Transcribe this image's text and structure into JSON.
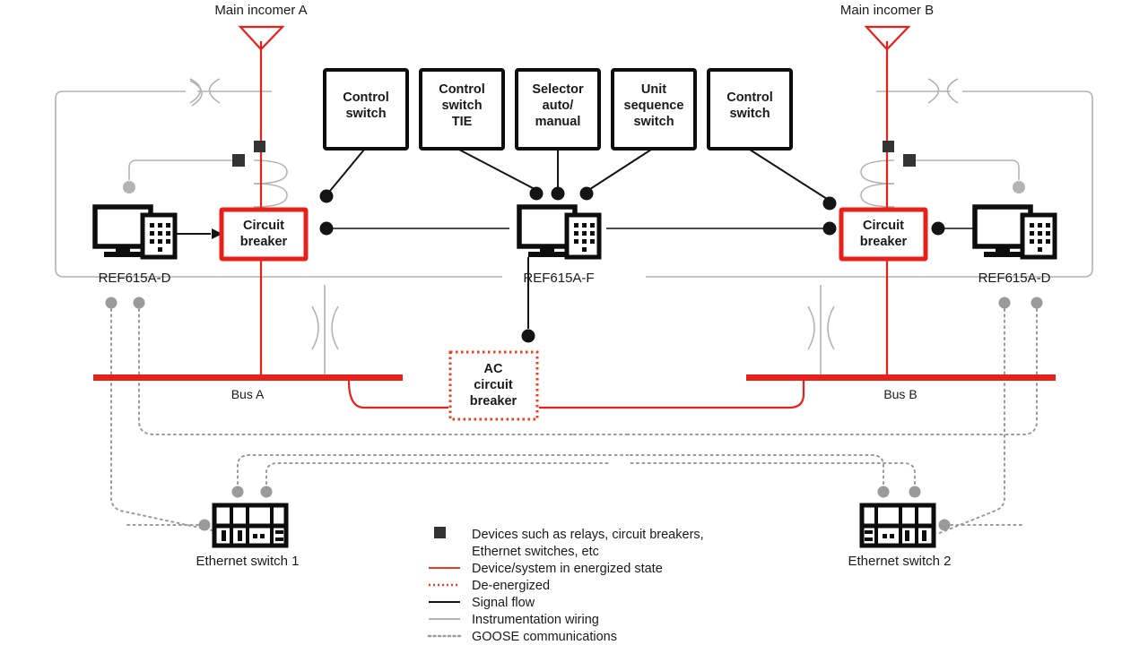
{
  "diagram": {
    "title": "Substation busbar protection single line diagram",
    "colors": {
      "energized": "#E8201A",
      "deenergized": "#EF3B24",
      "signal": "#141414",
      "instrumentation": "#B3B3B3",
      "goose": "#9A9A9A",
      "device_marker": "#333333",
      "background": "#FFFFFF"
    }
  },
  "incomers": [
    {
      "id": "incomer-a",
      "label": "Main incomer A"
    },
    {
      "id": "incomer-b",
      "label": "Main incomer B"
    }
  ],
  "switch_boxes": [
    {
      "id": "control-switch-a",
      "lines": [
        "Control",
        "switch"
      ]
    },
    {
      "id": "control-switch-tie",
      "lines": [
        "Control",
        "switch",
        "TIE"
      ]
    },
    {
      "id": "selector-auto-manual",
      "lines": [
        "Selector",
        "auto/",
        "manual"
      ]
    },
    {
      "id": "unit-sequence-switch",
      "lines": [
        "Unit",
        "sequence",
        "switch"
      ]
    },
    {
      "id": "control-switch-b",
      "lines": [
        "Control",
        "switch"
      ]
    }
  ],
  "breakers": [
    {
      "id": "circuit-breaker-a",
      "lines": [
        "Circuit",
        "breaker"
      ],
      "state": "energized"
    },
    {
      "id": "circuit-breaker-b",
      "lines": [
        "Circuit",
        "breaker"
      ],
      "state": "energized"
    }
  ],
  "ac_circuit_breaker": {
    "id": "ac-circuit-breaker",
    "lines": [
      "AC",
      "circuit",
      "breaker"
    ],
    "state": "de-energized"
  },
  "ieds": [
    {
      "id": "ied-left",
      "label": "REF615A-D"
    },
    {
      "id": "ied-center",
      "label": "REF615A-F"
    },
    {
      "id": "ied-right",
      "label": "REF615A-D"
    }
  ],
  "buses": [
    {
      "id": "bus-a",
      "label": "Bus A",
      "state": "energized"
    },
    {
      "id": "bus-b",
      "label": "Bus B",
      "state": "energized"
    }
  ],
  "ethernet_switches": [
    {
      "id": "ethernet-switch-1",
      "label": "Ethernet switch 1"
    },
    {
      "id": "ethernet-switch-2",
      "label": "Ethernet switch 2"
    }
  ],
  "legend": {
    "items": [
      {
        "id": "legend-devices",
        "symbol": "filled-square",
        "lines": [
          "Devices such as relays, circuit breakers,",
          "Ethernet switches, etc"
        ]
      },
      {
        "id": "legend-energized",
        "symbol": "solid-red-line",
        "lines": [
          "Device/system in energized state"
        ]
      },
      {
        "id": "legend-deenergized",
        "symbol": "dotted-red-line",
        "lines": [
          "De-energized"
        ]
      },
      {
        "id": "legend-signal",
        "symbol": "solid-black-line",
        "lines": [
          "Signal flow"
        ]
      },
      {
        "id": "legend-instrumentation",
        "symbol": "solid-gray-line",
        "lines": [
          "Instrumentation wiring"
        ]
      },
      {
        "id": "legend-goose",
        "symbol": "dotted-gray-line",
        "lines": [
          "GOOSE communications"
        ]
      }
    ]
  }
}
